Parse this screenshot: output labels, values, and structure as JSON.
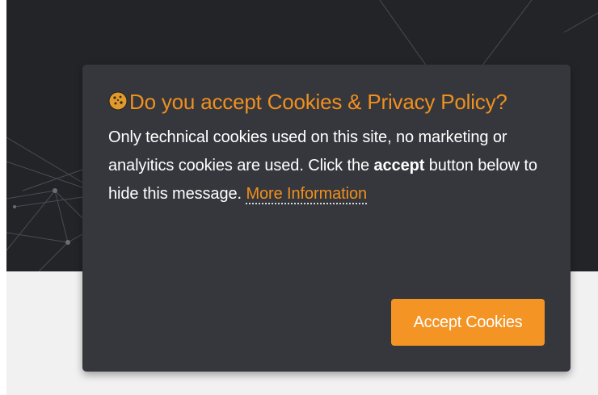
{
  "cookie_notice": {
    "title": "Do you accept Cookies & Privacy Policy?",
    "icon": "cookie-icon",
    "body_prefix": "Only technical cookies used on this site, no marketing or analyitics cookies are used. Click the",
    "body_bold": "accept",
    "body_suffix": "button below to hide this message.",
    "more_link": "More Information",
    "accept_button": "Accept Cookies"
  },
  "colors": {
    "accent": "#f39424",
    "title": "#f0901e",
    "modal_background": "#35373c",
    "hero_background": "#232428",
    "page_background": "#f1f1f2"
  }
}
